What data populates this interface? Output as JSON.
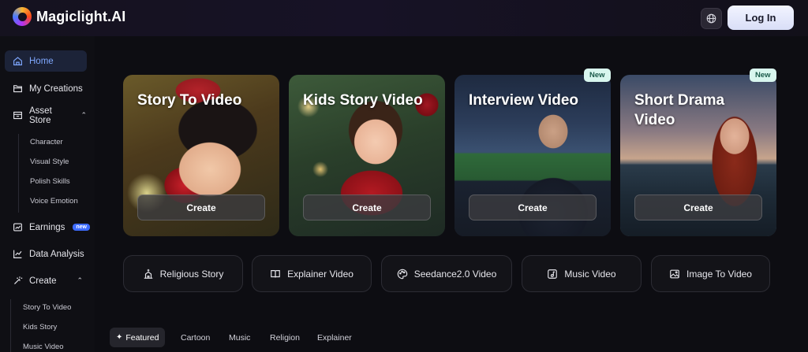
{
  "header": {
    "logo_text": "Magiclight.AI",
    "language_icon": "globe-icon",
    "login_label": "Log In"
  },
  "sidebar": {
    "items": [
      {
        "label": "Home",
        "icon": "home-icon",
        "active": true
      },
      {
        "label": "My Creations",
        "icon": "folder-icon"
      },
      {
        "label": "Asset Store",
        "icon": "store-icon",
        "expanded": true
      },
      {
        "label": "Earnings",
        "icon": "chart-icon",
        "badge": "new"
      },
      {
        "label": "Data Analysis",
        "icon": "analytics-icon"
      },
      {
        "label": "Create",
        "icon": "magic-wand-icon",
        "expanded": true
      }
    ],
    "asset_store_sub": [
      "Character",
      "Visual Style",
      "Polish Skills",
      "Voice Emotion"
    ],
    "create_sub": [
      "Story To Video",
      "Kids Story",
      "Music Video"
    ]
  },
  "cards": [
    {
      "title": "Story To Video",
      "button": "Create"
    },
    {
      "title": "Kids Story Video",
      "button": "Create"
    },
    {
      "title": "Interview Video",
      "button": "Create",
      "badge": "New"
    },
    {
      "title": "Short Drama Video",
      "button": "Create",
      "badge": "New"
    }
  ],
  "tools": [
    {
      "label": "Religious Story",
      "icon": "church-icon"
    },
    {
      "label": "Explainer Video",
      "icon": "book-icon"
    },
    {
      "label": "Seedance2.0 Video",
      "icon": "palette-icon"
    },
    {
      "label": "Music Video",
      "icon": "music-note-icon"
    },
    {
      "label": "Image To Video",
      "icon": "image-icon"
    }
  ],
  "tabs": [
    "Featured",
    "Cartoon",
    "Music",
    "Religion",
    "Explainer"
  ],
  "colors": {
    "accent": "#3d6bff",
    "active_nav_text": "#7fa8ff",
    "new_badge_bg": "#d8f6ee"
  }
}
